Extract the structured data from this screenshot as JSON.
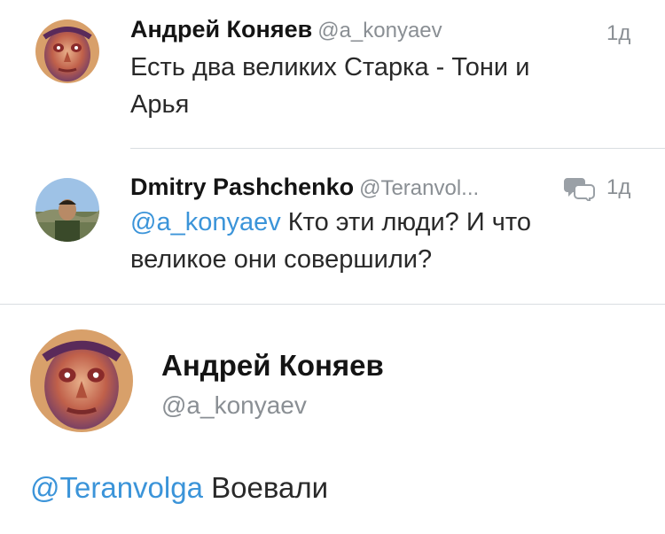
{
  "tweets": [
    {
      "author": "Андрей Коняев",
      "handle": "@a_konyaev",
      "time": "1д",
      "text_line1": "Есть два великих Старка - Тони и",
      "text_line2": "Арья",
      "avatar_icon": "avatar-face-art"
    },
    {
      "author": "Dmitry Pashchenko",
      "handle": "@Teranvol...",
      "time": "1д",
      "mention": "@a_konyaev",
      "text_line1": " Кто эти люди? И что",
      "text_line2": "великое они совершили?",
      "avatar_icon": "avatar-photo",
      "conversation_icon": "conversation-bubbles-icon"
    }
  ],
  "focused": {
    "author": "Андрей Коняев",
    "handle": "@a_konyaev",
    "mention": "@Teranvolga",
    "text": " Воевали",
    "avatar_icon": "avatar-face-art"
  },
  "colors": {
    "link": "#3b94d9",
    "secondary": "#8a8f94",
    "divider": "#d9dde1"
  }
}
